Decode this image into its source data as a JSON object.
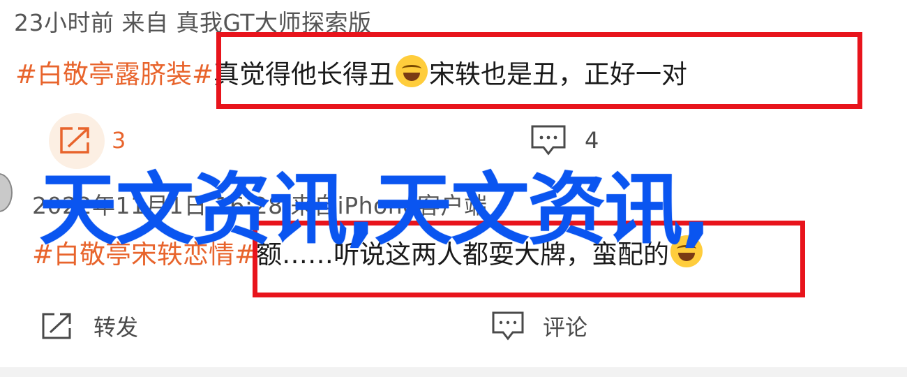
{
  "post1": {
    "meta": "23小时前  来自  真我GT大师探索版",
    "tag": "#白敬亭露脐装#",
    "text_before_emoji": "真觉得他长得丑",
    "emoji": "crying-laughing-emoji",
    "text_after_emoji": "宋轶也是丑，正好一对",
    "repost_count": "3",
    "comment_count": "4"
  },
  "post2": {
    "meta": "2022年11月1日 16:28 来自iPhone客户端",
    "tag": "#白敬亭宋轶恋情#",
    "text": "额……听说这两人都耍大牌，蛮配的",
    "emoji": "laughing-tears-emoji",
    "repost_label": "转发",
    "comment_label": "评论"
  },
  "overlay": {
    "text": "天文资讯,天文资讯,"
  },
  "colors": {
    "tag": "#e8642c",
    "highlight_box": "#e8141c",
    "overlay_text": "#0a55f0"
  }
}
